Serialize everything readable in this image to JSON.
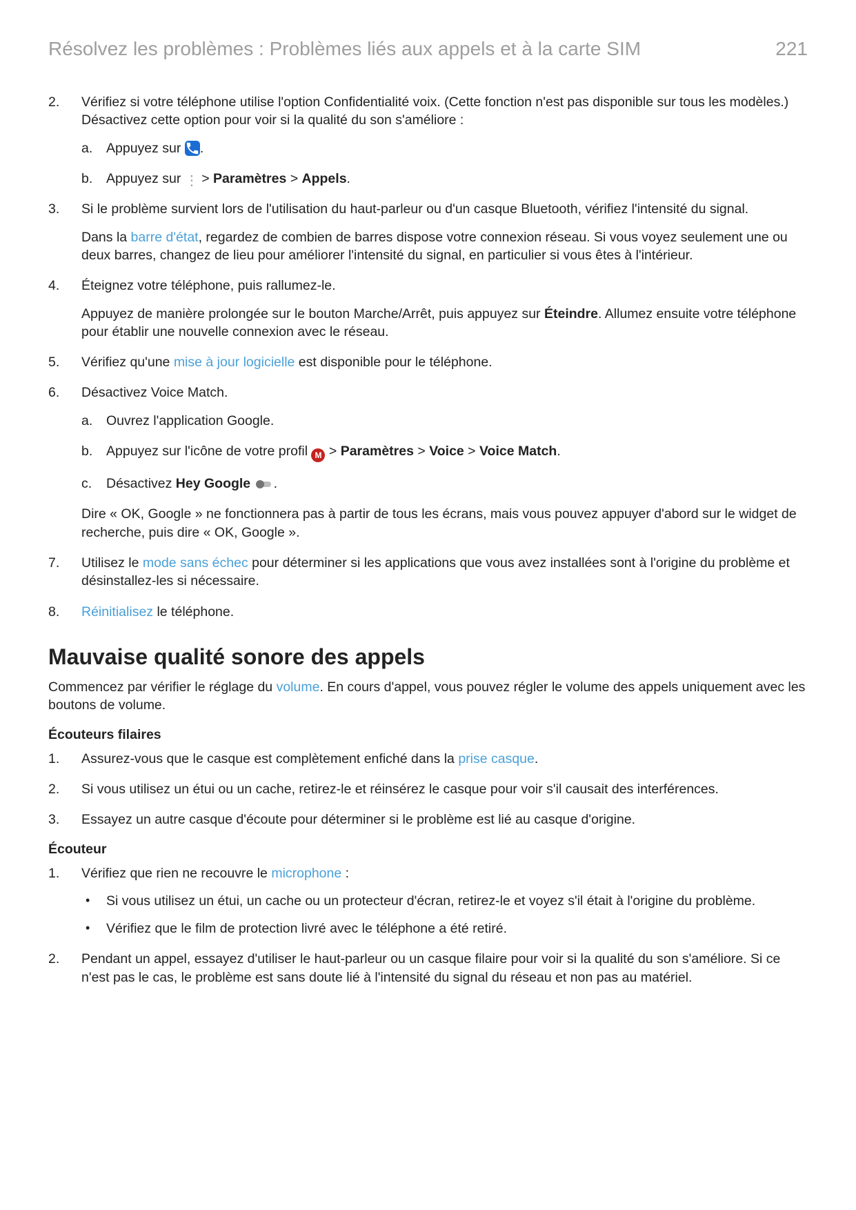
{
  "header": {
    "breadcrumb": "Résolvez les problèmes : Problèmes liés aux appels et à la carte SIM",
    "page_number": "221"
  },
  "strings": {
    "s2_a": "Vérifiez si votre téléphone utilise l'option Confidentialité voix. (Cette fonction n'est pas disponible sur tous les modèles.) Désactivez cette option pour voir si la qualité du son s'améliore :",
    "s2a_pre": "Appuyez sur ",
    "s2a_post": ".",
    "s2b_pre": "Appuyez sur ",
    "s2b_arrow1": " > ",
    "s2b_b1": "Paramètres",
    "s2b_arrow2": " > ",
    "s2b_b2": "Appels",
    "s2b_post": ".",
    "s3": "Si le problème survient lors de l'utilisation du haut-parleur ou d'un casque Bluetooth, vérifiez l'intensité du signal.",
    "s3_p_pre": "Dans la ",
    "s3_link": "barre d'état",
    "s3_p_post": ", regardez de combien de barres dispose votre connexion réseau. Si vous voyez seulement une ou deux barres, changez de lieu pour améliorer l'intensité du signal, en particulier si vous êtes à l'intérieur.",
    "s4": "Éteignez votre téléphone, puis rallumez-le.",
    "s4_p_pre": "Appuyez de manière prolongée sur le bouton Marche/Arrêt, puis appuyez sur ",
    "s4_b": "Éteindre",
    "s4_p_post": ". Allumez ensuite votre téléphone pour établir une nouvelle connexion avec le réseau.",
    "s5_pre": "Vérifiez qu'une ",
    "s5_link": "mise à jour logicielle",
    "s5_post": " est disponible pour le téléphone.",
    "s6": "Désactivez Voice Match.",
    "s6a": "Ouvrez l'application Google.",
    "s6b_pre": "Appuyez sur l'icône de votre profil ",
    "s6b_arrow1": " > ",
    "s6b_b1": "Paramètres",
    "s6b_arrow2": " > ",
    "s6b_b2": "Voice",
    "s6b_arrow3": " > ",
    "s6b_b3": "Voice Match",
    "s6b_post": ".",
    "s6c_pre": "Désactivez ",
    "s6c_b": "Hey Google",
    "s6c_post": " .",
    "s6_p": "Dire « OK, Google » ne fonctionnera pas à partir de tous les écrans, mais vous pouvez appuyer d'abord sur le widget de recherche, puis dire « OK, Google ».",
    "s7_pre": "Utilisez le ",
    "s7_link": "mode sans échec",
    "s7_post": " pour déterminer si les applications que vous avez installées sont à l'origine du problème et désinstallez-les si nécessaire.",
    "s8_link": "Réinitialisez",
    "s8_post": " le téléphone."
  },
  "section2": {
    "title": "Mauvaise qualité sonore des appels",
    "intro_pre": "Commencez par vérifier le réglage du ",
    "intro_link": "volume",
    "intro_post": ". En cours d'appel, vous pouvez régler le volume des appels uniquement avec les boutons de volume.",
    "sub1": "Écouteurs filaires",
    "a1_pre": "Assurez-vous que le casque est complètement enfiché dans la ",
    "a1_link": "prise casque",
    "a1_post": ".",
    "a2": "Si vous utilisez un étui ou un cache, retirez-le et réinsérez le casque pour voir s'il causait des interférences.",
    "a3": "Essayez un autre casque d'écoute pour déterminer si le problème est lié au casque d'origine.",
    "sub2": "Écouteur",
    "b1_pre": "Vérifiez que rien ne recouvre le ",
    "b1_link": "microphone",
    "b1_post": " :",
    "b1_bul1": "Si vous utilisez un étui, un cache ou un protecteur d'écran, retirez-le et voyez s'il était à l'origine du problème.",
    "b1_bul2": "Vérifiez que le film de protection livré avec le téléphone a été retiré.",
    "b2": "Pendant un appel, essayez d'utiliser le haut-parleur ou un casque filaire pour voir si la qualité du son s'améliore. Si ce n'est pas le cas, le problème est sans doute lié à l'intensité du signal du réseau et non pas au matériel."
  }
}
